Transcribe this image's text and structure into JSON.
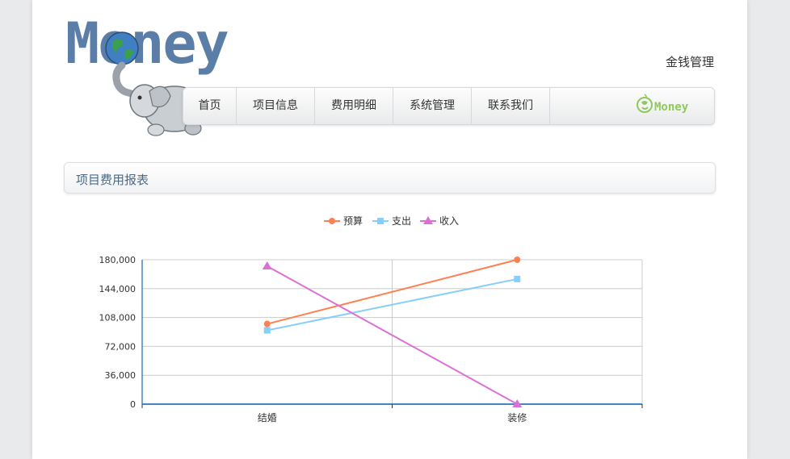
{
  "logo": {
    "text": "Money",
    "icon": "elephant-globe-logo"
  },
  "site_title": "金钱管理",
  "nav": {
    "items": [
      "首页",
      "项目信息",
      "费用明细",
      "系统管理",
      "联系我们"
    ],
    "brand_text": "Money",
    "brand_icon": "recycle-leaf-icon"
  },
  "panel": {
    "title": "项目费用报表"
  },
  "colors": {
    "budget": "#ff7f50",
    "expense": "#87cefa",
    "income": "#da70d6",
    "axis": "#48b",
    "grid": "#ccc"
  },
  "chart_data": {
    "type": "line",
    "categories": [
      "结婚",
      "装修"
    ],
    "series": [
      {
        "name": "预算",
        "marker": "circle",
        "values": [
          100000,
          180000
        ]
      },
      {
        "name": "支出",
        "marker": "square",
        "values": [
          92000,
          156000
        ]
      },
      {
        "name": "收入",
        "marker": "triangle",
        "values": [
          172000,
          0
        ]
      }
    ],
    "ylim": [
      0,
      180000
    ],
    "yticks": [
      "0",
      "36,000",
      "72,000",
      "108,000",
      "144,000",
      "180,000"
    ],
    "grid": true,
    "legend": "top-center"
  }
}
